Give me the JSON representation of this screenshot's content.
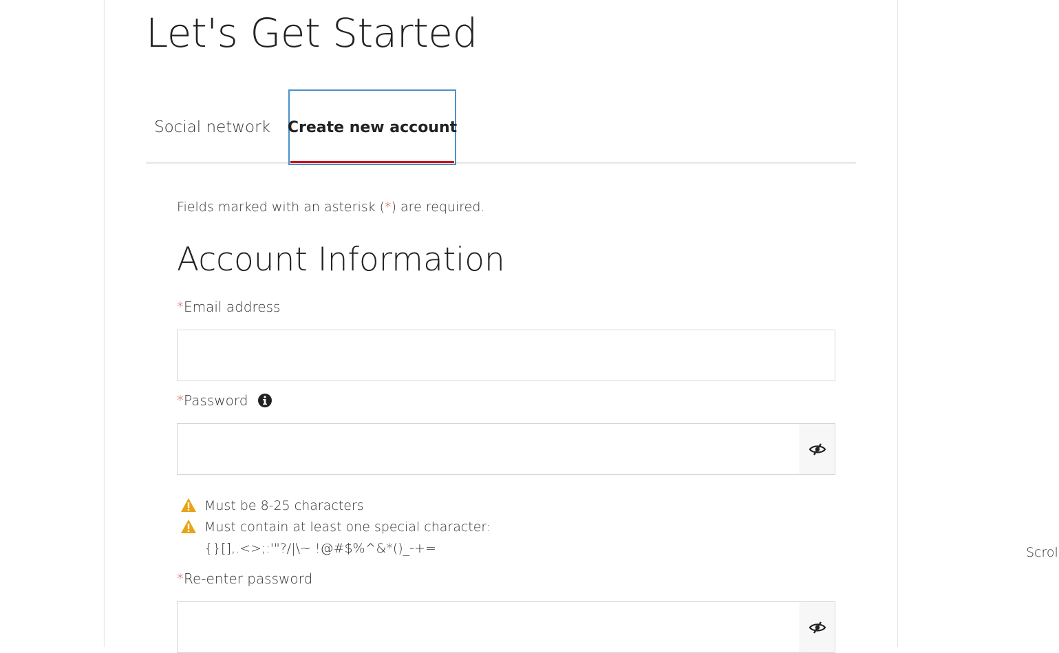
{
  "header": {
    "title": "Let's Get Started"
  },
  "tabs": [
    {
      "label": "Social network",
      "selected": false
    },
    {
      "label": "Create new account",
      "selected": true
    }
  ],
  "form": {
    "required_note_prefix": "Fields marked with an asterisk (",
    "required_star": "*",
    "required_note_suffix": ") are required.",
    "section_title": "Account Information",
    "email": {
      "label": "Email address",
      "value": "",
      "placeholder": ""
    },
    "password": {
      "label": "Password",
      "value": "",
      "placeholder": ""
    },
    "reenter_password": {
      "label": "Re-enter password",
      "value": "",
      "placeholder": ""
    },
    "password_rules": [
      "Must be 8-25 characters",
      "Must contain at least one special character: {}[],.<>;:'\"?/|\\~ !@#$%^&*()_-+="
    ]
  },
  "scroll_hint": "Scroll",
  "colors": {
    "accent_red": "#d0021b",
    "focus_blue": "#4a90c8",
    "warning_amber": "#e8a317",
    "required_star": "#c0392b"
  },
  "icons": {
    "info": "info-circle-icon",
    "warning": "warning-triangle-icon",
    "eye": "eye-slash-icon"
  }
}
